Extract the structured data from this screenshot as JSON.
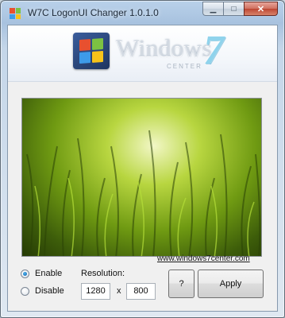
{
  "window": {
    "title": "W7C LogonUI Changer 1.0.1.0",
    "minimize_symbol": "▁",
    "maximize_symbol": "□",
    "close_symbol": "✕"
  },
  "banner": {
    "logo_icon": "windows-flag-icon",
    "wordmark": "Windows",
    "wordmark_sub": "CENTER",
    "wordmark_number": "7"
  },
  "link": {
    "text": "www.windows7center.com"
  },
  "mode": {
    "options": [
      {
        "label": "Enable",
        "selected": true
      },
      {
        "label": "Disable",
        "selected": false
      }
    ]
  },
  "resolution": {
    "label": "Resolution:",
    "width": "1280",
    "separator": "x",
    "height": "800"
  },
  "buttons": {
    "help": "?",
    "apply": "Apply"
  },
  "colors": {
    "flag_red": "#e8502f",
    "flag_green": "#7cc242",
    "flag_blue": "#3d9be9",
    "flag_yellow": "#f6c31a",
    "close_red": "#bd4632"
  }
}
